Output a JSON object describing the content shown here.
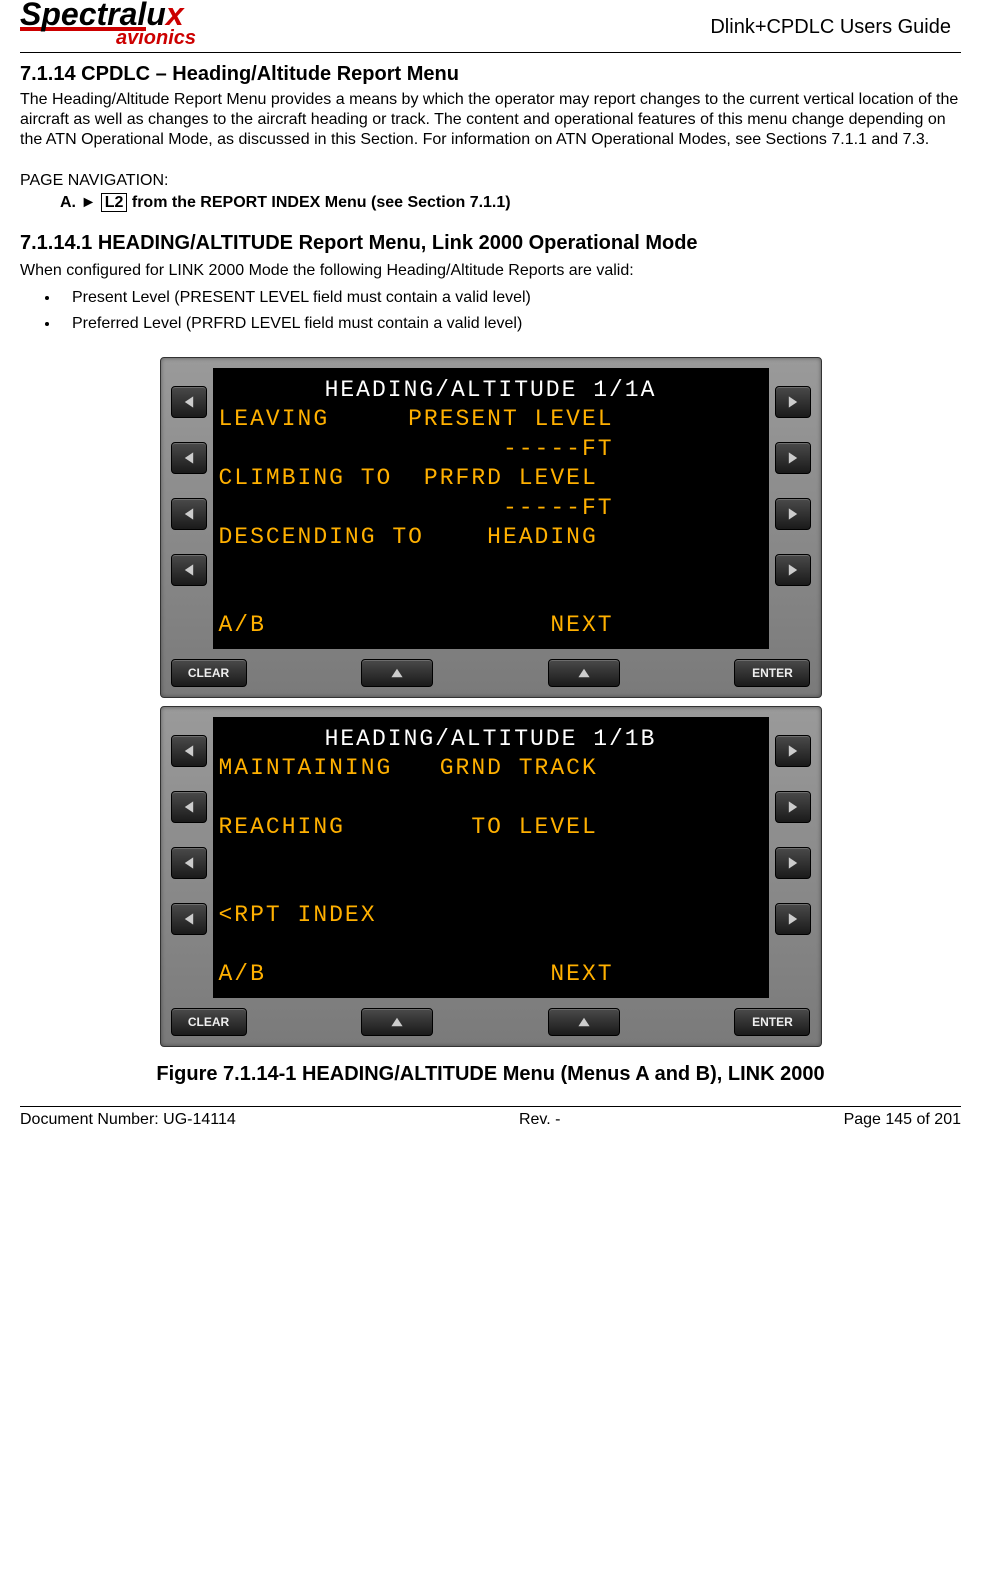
{
  "header": {
    "logo_main": "Spectralux",
    "logo_sub": "avionics",
    "doc_title": "Dlink+CPDLC Users Guide"
  },
  "section": {
    "number_title": "7.1.14 CPDLC – Heading/Altitude Report Menu",
    "intro": "The Heading/Altitude Report Menu provides a means by which the operator may report changes to the current vertical location of the aircraft as well as changes to the aircraft heading or track. The content and operational features of this menu change depending on the ATN Operational Mode, as discussed in this Section. For information on ATN Operational Modes, see Sections 7.1.1 and 7.3.",
    "nav_label": "PAGE NAVIGATION:",
    "nav_item_prefix": "A.   ►",
    "nav_item_box": "L2",
    "nav_item_suffix": " from the REPORT INDEX Menu (see Section 7.1.1)"
  },
  "subsection": {
    "title": "7.1.14.1        HEADING/ALTITUDE Report Menu, Link 2000 Operational Mode",
    "lead": "When configured for LINK 2000 Mode the following Heading/Altitude Reports are valid:",
    "bullets": [
      "Present Level (PRESENT LEVEL field must contain a valid level)",
      "Preferred Level (PRFRD LEVEL field must contain a valid level)"
    ]
  },
  "cdu_a": {
    "title": "HEADING/ALTITUDE 1/1A",
    "body": "LEAVING     PRESENT LEVEL\n                  -----FT\nCLIMBING TO  PRFRD LEVEL\n                  -----FT\nDESCENDING TO    HEADING\n\n\nA/B                  NEXT"
  },
  "cdu_b": {
    "title": "HEADING/ALTITUDE 1/1B",
    "body": "MAINTAINING   GRND TRACK\n\nREACHING        TO LEVEL\n\n\n<RPT INDEX\n\nA/B                  NEXT"
  },
  "buttons": {
    "clear": "CLEAR",
    "enter": "ENTER"
  },
  "figure_caption": "Figure 7.1.14-1 HEADING/ALTITUDE Menu (Menus A and B), LINK 2000",
  "footer": {
    "left": "Document Number:  UG-14114",
    "center": "Rev. -",
    "right": "Page 145 of 201"
  }
}
